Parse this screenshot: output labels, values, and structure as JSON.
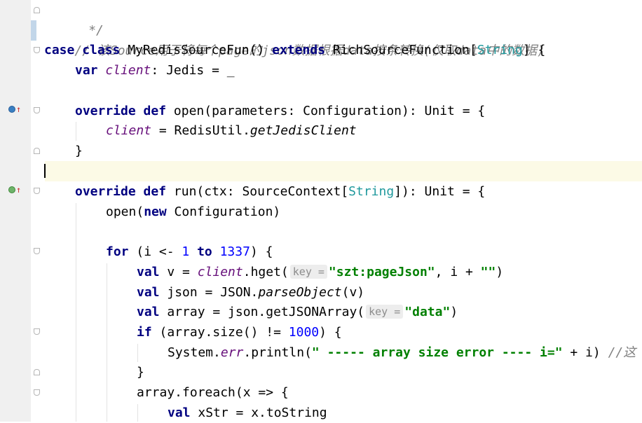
{
  "editor": {
    "line_numbers": [
      "",
      "",
      "",
      "",
      "",
      "",
      "",
      "",
      "",
      "",
      "",
      "",
      "",
      "",
      "",
      "",
      "",
      "",
      "",
      "",
      ""
    ],
    "lines": {
      "l0": {
        "comment": " */"
      },
      "l1": {
        "comment": "// 该Source用于将每个page的json数据根据data按条转换(仅取data中的数据)"
      },
      "l2": {
        "kw_case": "case",
        "kw_class": "class",
        "name": "MyRedisSourceFun() ",
        "kw_extends": "extends",
        "base": "RichSourceFunction[",
        "type": "String",
        "tail": "] {"
      },
      "l3": {
        "kw_var": "var",
        "field": "client",
        "rest": ": Jedis = _"
      },
      "l5": {
        "kw_override": "override",
        "kw_def": "def",
        "sig": "open(parameters: Configuration): Unit = {"
      },
      "l6": {
        "field": "client",
        "mid": " = RedisUtil.",
        "call": "getJedisClient"
      },
      "l7": {
        "brace": "}"
      },
      "l9": {
        "kw_override": "override",
        "kw_def": "def",
        "sig_a": "run(ctx: SourceContext[",
        "type": "String",
        "sig_b": "]): Unit = {"
      },
      "l10": {
        "call": "open(",
        "kw_new": "new",
        "rest": " Configuration)"
      },
      "l12": {
        "kw_for": "for",
        "a": " (i <- ",
        "n1": "1",
        "kw_to": "to",
        "n2": "1337",
        "b": ") {"
      },
      "l13": {
        "kw_val": "val",
        "a": " v = ",
        "field": "client",
        "b": ".hget(",
        "hint": "key =",
        "str": "\"szt:pageJson\"",
        "c": ", i + ",
        "str2": "\"\"",
        "d": ")"
      },
      "l14": {
        "kw_val": "val",
        "a": " json = JSON.",
        "call": "parseObject",
        "b": "(v)"
      },
      "l15": {
        "kw_val": "val",
        "a": " array = json.getJSONArray(",
        "hint": "key =",
        "str": "\"data\"",
        "b": ")"
      },
      "l16": {
        "kw_if": "if",
        "a": " (array.size() != ",
        "num": "1000",
        "b": ") {"
      },
      "l17": {
        "a": "System.",
        "field": "err",
        "b": ".println(",
        "str": "\" ----- array size error ---- i=\"",
        "c": " + i) ",
        "comment": "//这"
      },
      "l18": {
        "brace": "}"
      },
      "l19": {
        "a": "array.foreach(x => {"
      },
      "l20": {
        "kw_val": "val",
        "a": " xStr = x.toString"
      }
    }
  },
  "colors": {
    "keyword": "#000080",
    "type": "#20999d",
    "field": "#660e7a",
    "string": "#008000",
    "number": "#0000ff",
    "comment": "#808080",
    "current_line": "#fcfae6"
  },
  "gutter_icons": [
    "implements-icon",
    "override-arrow-icon",
    "implements-icon",
    "override-arrow-icon"
  ]
}
